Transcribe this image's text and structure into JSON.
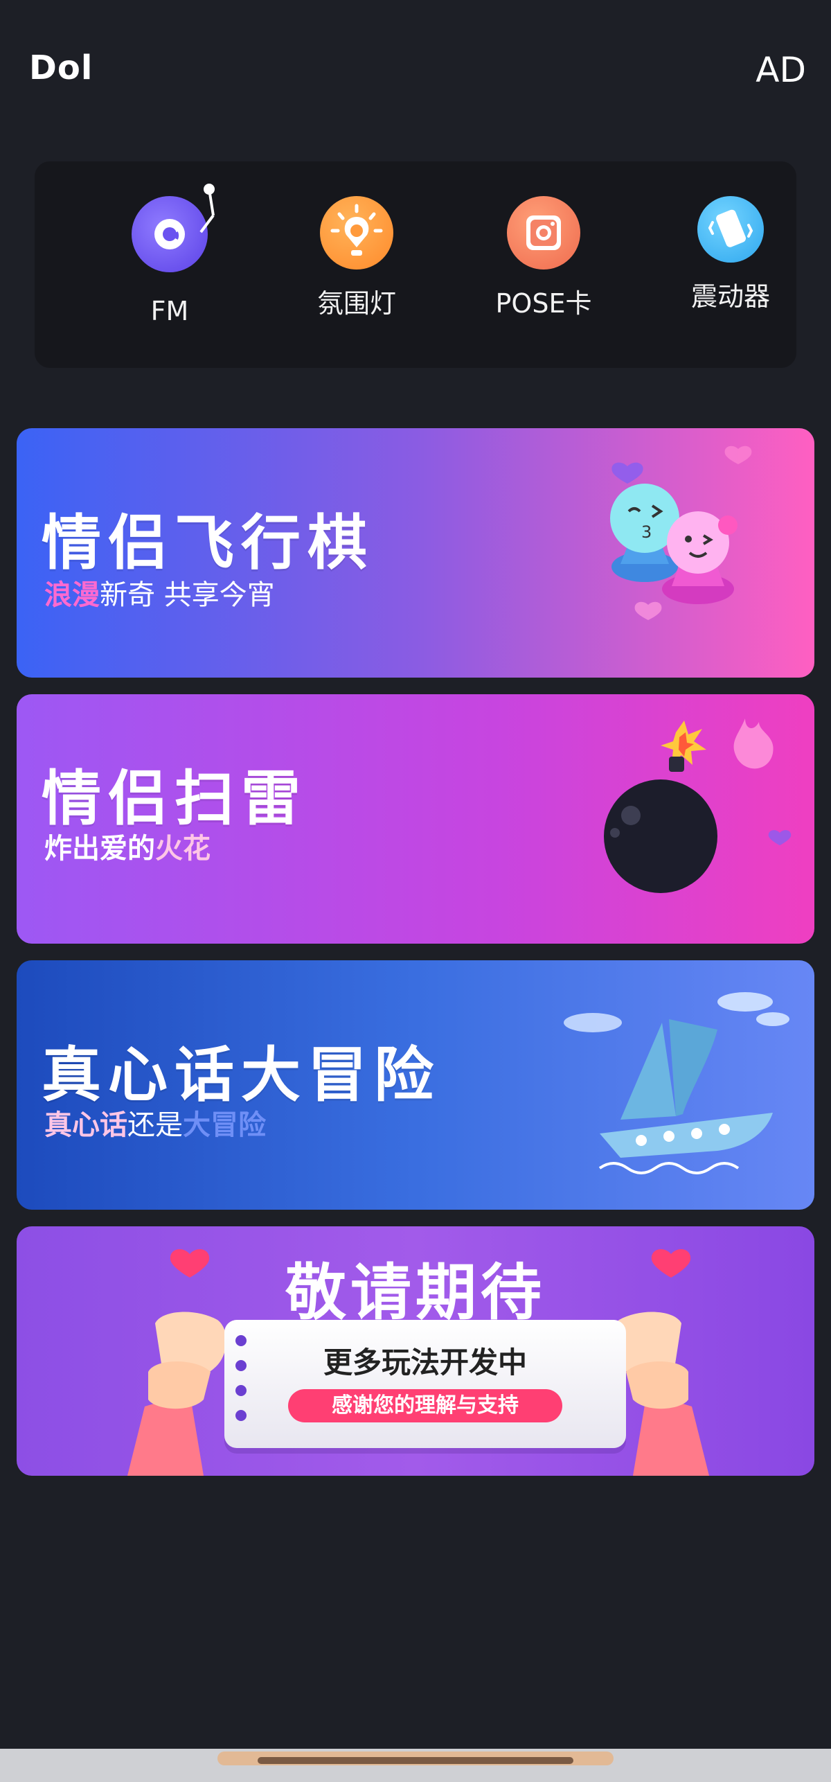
{
  "header": {
    "app_title": "Dol",
    "ad_label": "AD"
  },
  "tools": [
    {
      "label": "FM",
      "icon": "vinyl-record-icon"
    },
    {
      "label": "氛围灯",
      "icon": "lamp-icon"
    },
    {
      "label": "POSE卡",
      "icon": "camera-card-icon"
    },
    {
      "label": "震动器",
      "icon": "vibration-phone-icon"
    }
  ],
  "cards": [
    {
      "title": "情侣飞行棋",
      "sub_highlight": "浪漫",
      "sub_rest": "新奇 共享今宵"
    },
    {
      "title": "情侣扫雷",
      "sub_rest": "炸出爱的",
      "sub_highlight": "火花"
    },
    {
      "title": "真心话大冒险",
      "sub_a": "真心话",
      "sub_b": "还是",
      "sub_c": "大冒险"
    },
    {
      "title": "敬请期待",
      "note_title": "更多玩法开发中",
      "note_pill": "感谢您的理解与支持"
    }
  ],
  "colors": {
    "background": "#1d1f26",
    "panel": "#16171c",
    "accent_pink": "#ff6ad0",
    "pill_red": "#ff3f73"
  }
}
